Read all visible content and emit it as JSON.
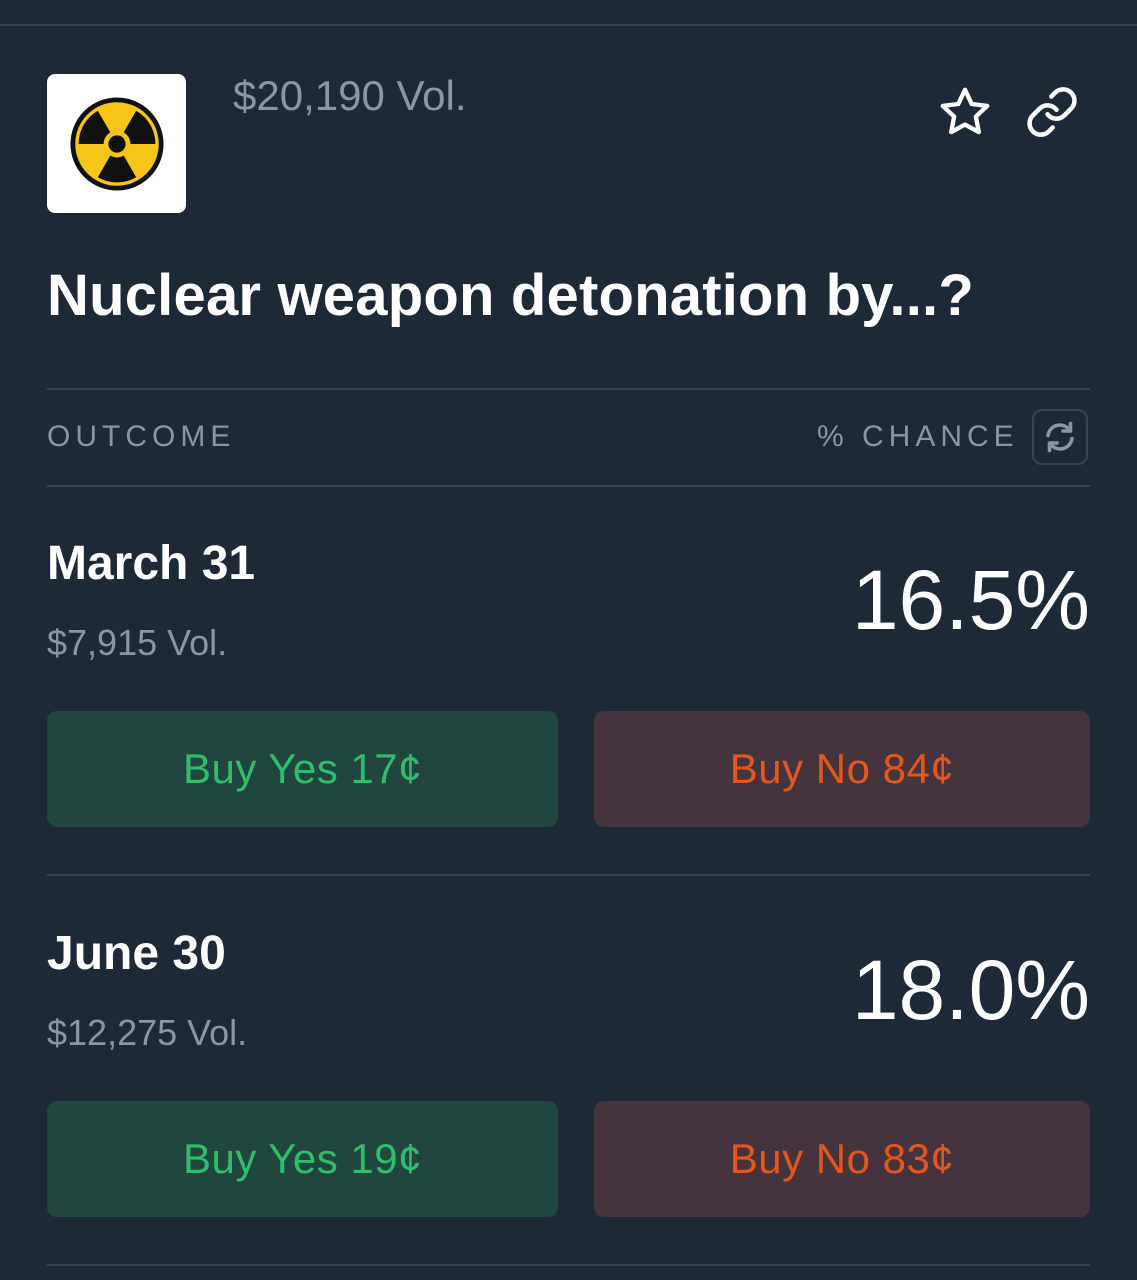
{
  "market": {
    "volume": "$20,190 Vol.",
    "title": "Nuclear weapon detonation by...?",
    "logo_icon": "radiation-icon"
  },
  "actions": {
    "favorite_icon": "star-icon",
    "share_icon": "link-icon"
  },
  "table": {
    "outcome_header": "OUTCOME",
    "chance_header": "% CHANCE",
    "refresh_icon": "refresh-icon"
  },
  "outcomes": [
    {
      "label": "March 31",
      "volume": "$7,915 Vol.",
      "chance": "16.5%",
      "yes_label": "Buy Yes 17¢",
      "no_label": "Buy No 84¢"
    },
    {
      "label": "June 30",
      "volume": "$12,275 Vol.",
      "chance": "18.0%",
      "yes_label": "Buy Yes 19¢",
      "no_label": "Buy No 83¢"
    }
  ],
  "colors": {
    "background": "#1e2937",
    "yes_text": "#2fbf6a",
    "yes_bg": "#20463f",
    "no_text": "#e4571c",
    "no_bg": "#45343d",
    "muted_text": "#8a95a5",
    "divider": "#34445a"
  }
}
